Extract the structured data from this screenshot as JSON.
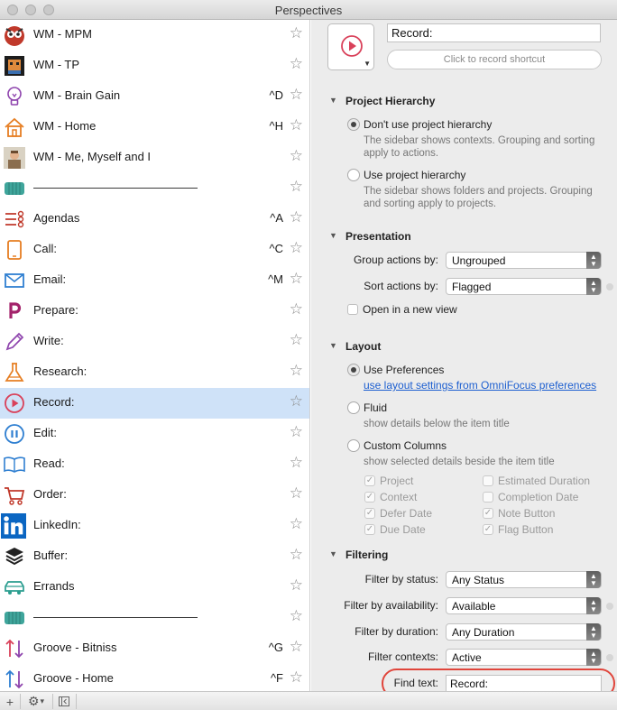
{
  "window": {
    "title": "Perspectives"
  },
  "sidebar": {
    "items": [
      {
        "label": "WM - MPM",
        "shortcut": "",
        "icon": "owl-avatar-icon",
        "selected": false
      },
      {
        "label": "WM - TP",
        "shortcut": "",
        "icon": "pixel-character-icon",
        "selected": false
      },
      {
        "label": "WM - Brain Gain",
        "shortcut": "^D",
        "icon": "lightbulb-icon",
        "selected": false
      },
      {
        "label": "WM - Home",
        "shortcut": "^H",
        "icon": "home-icon",
        "selected": false
      },
      {
        "label": "WM - Me, Myself and I",
        "shortcut": "",
        "icon": "person-photo-icon",
        "selected": false
      },
      {
        "label": "——————————————",
        "shortcut": "",
        "icon": "separator-folder-icon",
        "selected": false
      },
      {
        "label": "Agendas",
        "shortcut": "^A",
        "icon": "agenda-list-icon",
        "selected": false
      },
      {
        "label": "Call:",
        "shortcut": "^C",
        "icon": "phone-icon",
        "selected": false
      },
      {
        "label": "Email:",
        "shortcut": "^M",
        "icon": "envelope-icon",
        "selected": false
      },
      {
        "label": "Prepare:",
        "shortcut": "",
        "icon": "p-letter-icon",
        "selected": false
      },
      {
        "label": "Write:",
        "shortcut": "",
        "icon": "pencil-icon",
        "selected": false
      },
      {
        "label": "Research:",
        "shortcut": "",
        "icon": "flask-icon",
        "selected": false
      },
      {
        "label": "Record:",
        "shortcut": "",
        "icon": "record-play-icon",
        "selected": true
      },
      {
        "label": "Edit:",
        "shortcut": "",
        "icon": "pause-circle-icon",
        "selected": false
      },
      {
        "label": "Read:",
        "shortcut": "",
        "icon": "book-icon",
        "selected": false
      },
      {
        "label": "Order:",
        "shortcut": "",
        "icon": "cart-icon",
        "selected": false
      },
      {
        "label": "LinkedIn:",
        "shortcut": "",
        "icon": "linkedin-icon",
        "selected": false
      },
      {
        "label": "Buffer:",
        "shortcut": "",
        "icon": "layers-icon",
        "selected": false
      },
      {
        "label": "Errands",
        "shortcut": "",
        "icon": "car-icon",
        "selected": false
      },
      {
        "label": "——————————————",
        "shortcut": "",
        "icon": "separator-folder-icon",
        "selected": false
      },
      {
        "label": "Groove - Bitniss",
        "shortcut": "^G",
        "icon": "up-down-arrows-icon",
        "selected": false
      },
      {
        "label": "Groove - Home",
        "shortcut": "^F",
        "icon": "up-down-arrows-icon",
        "selected": false
      }
    ]
  },
  "detail": {
    "name_value": "Record:",
    "shortcut_placeholder": "Click to record shortcut",
    "project_hierarchy": {
      "title": "Project Hierarchy",
      "opt1_label": "Don't use project hierarchy",
      "opt1_desc": "The sidebar shows contexts. Grouping and sorting apply to actions.",
      "opt2_label": "Use project hierarchy",
      "opt2_desc": "The sidebar shows folders and projects. Grouping and sorting apply to projects."
    },
    "presentation": {
      "title": "Presentation",
      "group_label": "Group actions by:",
      "group_value": "Ungrouped",
      "sort_label": "Sort actions by:",
      "sort_value": "Flagged",
      "new_view_label": "Open in a new view"
    },
    "layout": {
      "title": "Layout",
      "use_prefs_label": "Use Preferences",
      "use_prefs_link": "use layout settings from OmniFocus preferences",
      "fluid_label": "Fluid",
      "fluid_desc": "show details below the item title",
      "custom_label": "Custom Columns",
      "custom_desc": "show selected details beside the item title",
      "columns": {
        "project": "Project",
        "context": "Context",
        "defer_date": "Defer Date",
        "due_date": "Due Date",
        "estimated_duration": "Estimated Duration",
        "completion_date": "Completion Date",
        "note_button": "Note Button",
        "flag_button": "Flag Button"
      },
      "check_glyph": "✓"
    },
    "filtering": {
      "title": "Filtering",
      "status_label": "Filter by status:",
      "status_value": "Any Status",
      "availability_label": "Filter by availability:",
      "availability_value": "Available",
      "duration_label": "Filter by duration:",
      "duration_value": "Any Duration",
      "contexts_label": "Filter contexts:",
      "contexts_value": "Active",
      "find_label": "Find text:",
      "find_value": "Record:"
    }
  },
  "bottombar": {
    "add": "+",
    "gear": "⚙",
    "gear_caret": "▾"
  },
  "colors": {
    "selection": "#cfe2f8",
    "accent_red": "#e0453b",
    "link": "#1d5fd0"
  }
}
